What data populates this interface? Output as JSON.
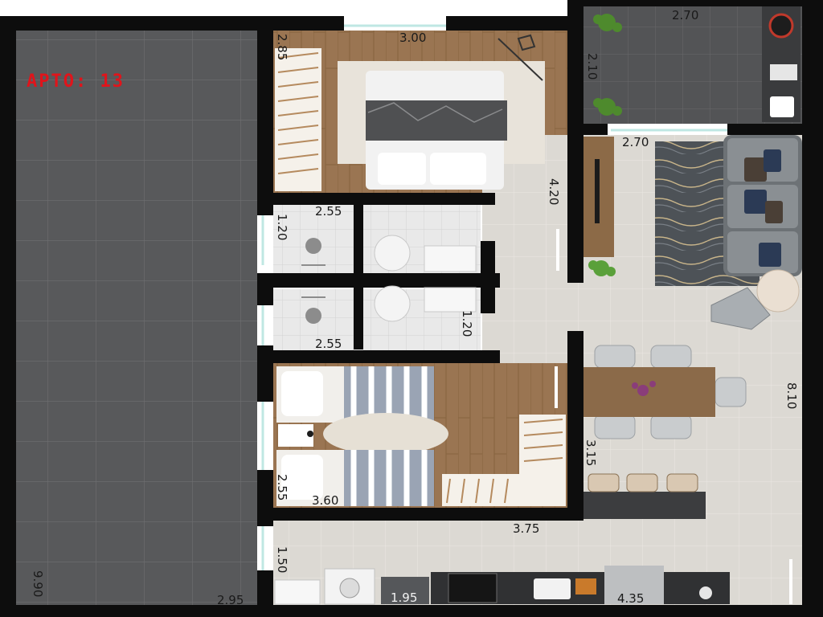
{
  "unit_label": "APTO: 13",
  "dimensions": {
    "terrace_width": "2.95",
    "terrace_length": "9.90",
    "suite_width": "3.00",
    "suite_wardrobe": "2.85",
    "suite_length": "4.20",
    "balcony_width": "2.70",
    "balcony_depth": "2.10",
    "living_width": "2.70",
    "living_length": "8.10",
    "bath1_width": "2.55",
    "bath1_depth": "1.20",
    "bath2_width": "2.55",
    "bath2_depth": "1.20",
    "bedroom2_width": "3.60",
    "bedroom2_depth": "2.55",
    "dining_depth": "3.15",
    "kitchen_width": "3.75",
    "kitchen_depth": "1.50",
    "laundry_width": "1.95",
    "counter_width": "4.35"
  },
  "colors": {
    "wall": "#0d0d0d",
    "terrace_floor": "#58595b",
    "wood_floor": "#9a7552",
    "tile_floor": "#dcd9d3",
    "label_red": "#e0141b"
  }
}
